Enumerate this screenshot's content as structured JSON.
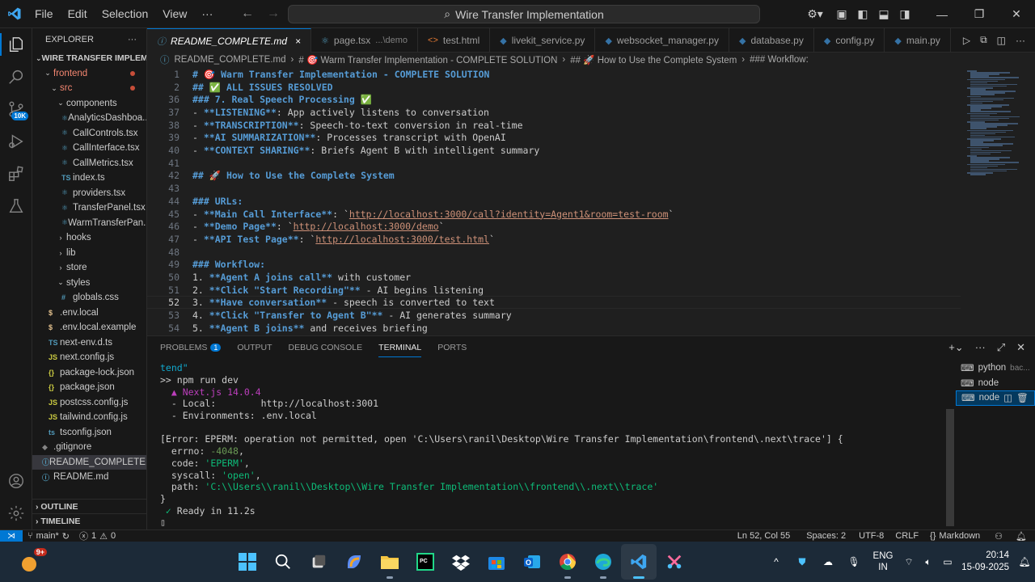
{
  "titlebar": {
    "menu": [
      "File",
      "Edit",
      "Selection",
      "View"
    ],
    "more": "···",
    "search": "Wire Transfer Implementation"
  },
  "activity": {
    "source_control_badge": "10K"
  },
  "explorer": {
    "title": "EXPLORER",
    "root": "WIRE TRANSFER IMPLEME...",
    "items": [
      {
        "label": "frontend",
        "indent": 1,
        "type": "folder-open",
        "modified": true
      },
      {
        "label": "src",
        "indent": 2,
        "type": "folder-open",
        "modified": true
      },
      {
        "label": "components",
        "indent": 3,
        "type": "folder-open"
      },
      {
        "label": "AnalyticsDashboa...",
        "indent": 4,
        "type": "tsx"
      },
      {
        "label": "CallControls.tsx",
        "indent": 4,
        "type": "tsx"
      },
      {
        "label": "CallInterface.tsx",
        "indent": 4,
        "type": "tsx"
      },
      {
        "label": "CallMetrics.tsx",
        "indent": 4,
        "type": "tsx"
      },
      {
        "label": "index.ts",
        "indent": 4,
        "type": "ts"
      },
      {
        "label": "providers.tsx",
        "indent": 4,
        "type": "tsx"
      },
      {
        "label": "TransferPanel.tsx",
        "indent": 4,
        "type": "tsx"
      },
      {
        "label": "WarmTransferPan...",
        "indent": 4,
        "type": "tsx"
      },
      {
        "label": "hooks",
        "indent": 3,
        "type": "folder"
      },
      {
        "label": "lib",
        "indent": 3,
        "type": "folder"
      },
      {
        "label": "store",
        "indent": 3,
        "type": "folder"
      },
      {
        "label": "styles",
        "indent": 3,
        "type": "folder-open"
      },
      {
        "label": "globals.css",
        "indent": 4,
        "type": "css"
      },
      {
        "label": ".env.local",
        "indent": 2,
        "type": "env"
      },
      {
        "label": ".env.local.example",
        "indent": 2,
        "type": "env"
      },
      {
        "label": "next-env.d.ts",
        "indent": 2,
        "type": "ts"
      },
      {
        "label": "next.config.js",
        "indent": 2,
        "type": "js"
      },
      {
        "label": "package-lock.json",
        "indent": 2,
        "type": "json"
      },
      {
        "label": "package.json",
        "indent": 2,
        "type": "json"
      },
      {
        "label": "postcss.config.js",
        "indent": 2,
        "type": "js"
      },
      {
        "label": "tailwind.config.js",
        "indent": 2,
        "type": "js"
      },
      {
        "label": "tsconfig.json",
        "indent": 2,
        "type": "tsconfig"
      },
      {
        "label": ".gitignore",
        "indent": 1,
        "type": "git"
      },
      {
        "label": "README_COMPLETE...",
        "indent": 1,
        "type": "md-info",
        "selected": true
      },
      {
        "label": "README.md",
        "indent": 1,
        "type": "md-info"
      }
    ],
    "outline": "OUTLINE",
    "timeline": "TIMELINE"
  },
  "tabs": [
    {
      "label": "README_COMPLETE.md",
      "icon": "info",
      "active": true,
      "close": "×"
    },
    {
      "label": "page.tsx",
      "desc": "...\\demo",
      "icon": "tsx"
    },
    {
      "label": "test.html",
      "icon": "html"
    },
    {
      "label": "livekit_service.py",
      "icon": "py"
    },
    {
      "label": "websocket_manager.py",
      "icon": "py"
    },
    {
      "label": "database.py",
      "icon": "py"
    },
    {
      "label": "config.py",
      "icon": "py"
    },
    {
      "label": "main.py",
      "icon": "py"
    }
  ],
  "breadcrumb": [
    "README_COMPLETE.md",
    "# 🎯 Warm Transfer Implementation - COMPLETE SOLUTION",
    "## 🚀 How to Use the Complete System",
    "### Workflow:"
  ],
  "editor": {
    "lines": [
      {
        "n": "1",
        "parts": [
          {
            "c": "h",
            "t": "# 🎯 Warm Transfer Implementation - COMPLETE SOLUTION"
          }
        ]
      },
      {
        "n": "2",
        "parts": [
          {
            "c": "h",
            "t": "## ✅ ALL ISSUES RESOLVED"
          }
        ]
      },
      {
        "n": "36",
        "parts": [
          {
            "c": "h",
            "t": "### 7. Real Speech Processing ✅"
          }
        ]
      },
      {
        "n": "37",
        "parts": [
          {
            "c": "t",
            "t": "- "
          },
          {
            "c": "b",
            "t": "**LISTENING**"
          },
          {
            "c": "t",
            "t": ": App actively listens to conversation"
          }
        ]
      },
      {
        "n": "38",
        "parts": [
          {
            "c": "t",
            "t": "- "
          },
          {
            "c": "b",
            "t": "**TRANSCRIPTION**"
          },
          {
            "c": "t",
            "t": ": Speech-to-text conversion in real-time"
          }
        ]
      },
      {
        "n": "39",
        "parts": [
          {
            "c": "t",
            "t": "- "
          },
          {
            "c": "b",
            "t": "**AI SUMMARIZATION**"
          },
          {
            "c": "t",
            "t": ": Processes transcript with OpenAI"
          }
        ]
      },
      {
        "n": "40",
        "parts": [
          {
            "c": "t",
            "t": "- "
          },
          {
            "c": "b",
            "t": "**CONTEXT SHARING**"
          },
          {
            "c": "t",
            "t": ": Briefs Agent B with intelligent summary"
          }
        ]
      },
      {
        "n": "41",
        "parts": []
      },
      {
        "n": "42",
        "parts": [
          {
            "c": "h",
            "t": "## 🚀 How to Use the Complete System"
          }
        ]
      },
      {
        "n": "43",
        "parts": []
      },
      {
        "n": "44",
        "parts": [
          {
            "c": "h",
            "t": "### URLs:"
          }
        ]
      },
      {
        "n": "45",
        "parts": [
          {
            "c": "t",
            "t": "- "
          },
          {
            "c": "b",
            "t": "**Main Call Interface**"
          },
          {
            "c": "t",
            "t": ": `"
          },
          {
            "c": "lk",
            "t": "http://localhost:3000/call?identity=Agent1&room=test-room"
          },
          {
            "c": "t",
            "t": "`"
          }
        ]
      },
      {
        "n": "46",
        "parts": [
          {
            "c": "t",
            "t": "- "
          },
          {
            "c": "b",
            "t": "**Demo Page**"
          },
          {
            "c": "t",
            "t": ": `"
          },
          {
            "c": "lk",
            "t": "http://localhost:3000/demo"
          },
          {
            "c": "t",
            "t": "`"
          }
        ]
      },
      {
        "n": "47",
        "parts": [
          {
            "c": "t",
            "t": "- "
          },
          {
            "c": "b",
            "t": "**API Test Page**"
          },
          {
            "c": "t",
            "t": ": `"
          },
          {
            "c": "lk",
            "t": "http://localhost:3000/test.html"
          },
          {
            "c": "t",
            "t": "`"
          }
        ]
      },
      {
        "n": "48",
        "parts": []
      },
      {
        "n": "49",
        "parts": [
          {
            "c": "h",
            "t": "### Workflow:"
          }
        ]
      },
      {
        "n": "50",
        "parts": [
          {
            "c": "t",
            "t": "1. "
          },
          {
            "c": "b",
            "t": "**Agent A joins call**"
          },
          {
            "c": "t",
            "t": " with customer"
          }
        ]
      },
      {
        "n": "51",
        "parts": [
          {
            "c": "t",
            "t": "2. "
          },
          {
            "c": "b",
            "t": "**Click \"Start Recording\"**"
          },
          {
            "c": "t",
            "t": " - AI begins listening"
          }
        ]
      },
      {
        "n": "52",
        "parts": [
          {
            "c": "t",
            "t": "3. "
          },
          {
            "c": "b",
            "t": "**Have conversation**"
          },
          {
            "c": "t",
            "t": " - speech is converted to text"
          }
        ],
        "current": true
      },
      {
        "n": "53",
        "parts": [
          {
            "c": "t",
            "t": "4. "
          },
          {
            "c": "b",
            "t": "**Click \"Transfer to Agent B\"**"
          },
          {
            "c": "t",
            "t": " - AI generates summary"
          }
        ]
      },
      {
        "n": "54",
        "parts": [
          {
            "c": "t",
            "t": "5. "
          },
          {
            "c": "b",
            "t": "**Agent B joins**"
          },
          {
            "c": "t",
            "t": " and receives briefing"
          }
        ]
      }
    ]
  },
  "panel": {
    "tabs": [
      {
        "label": "PROBLEMS",
        "badge": "1"
      },
      {
        "label": "OUTPUT"
      },
      {
        "label": "DEBUG CONSOLE"
      },
      {
        "label": "TERMINAL",
        "active": true
      },
      {
        "label": "PORTS"
      }
    ],
    "terminal": [
      {
        "parts": [
          {
            "c": "tc",
            "t": "tend\""
          }
        ]
      },
      {
        "parts": [
          {
            "c": "t",
            "t": ">> npm run dev"
          }
        ]
      },
      {
        "parts": [
          {
            "c": "tm",
            "t": "  ▲ Next.js 14.0.4"
          }
        ]
      },
      {
        "parts": [
          {
            "c": "t",
            "t": "  - Local:        http://localhost:3001"
          }
        ]
      },
      {
        "parts": [
          {
            "c": "t",
            "t": "  - Environments: .env.local"
          }
        ]
      },
      {
        "parts": []
      },
      {
        "parts": [
          {
            "c": "t",
            "t": "[Error: EPERM: operation not permitted, open 'C:\\Users\\ranil\\Desktop\\Wire Transfer Implementation\\frontend\\.next\\trace'] {"
          }
        ]
      },
      {
        "parts": [
          {
            "c": "t",
            "t": "  errno: "
          },
          {
            "c": "tgr",
            "t": "-4048"
          },
          {
            "c": "t",
            "t": ","
          }
        ]
      },
      {
        "parts": [
          {
            "c": "t",
            "t": "  code: "
          },
          {
            "c": "tg",
            "t": "'EPERM'"
          },
          {
            "c": "t",
            "t": ","
          }
        ]
      },
      {
        "parts": [
          {
            "c": "t",
            "t": "  syscall: "
          },
          {
            "c": "tg",
            "t": "'open'"
          },
          {
            "c": "t",
            "t": ","
          }
        ]
      },
      {
        "parts": [
          {
            "c": "t",
            "t": "  path: "
          },
          {
            "c": "tg",
            "t": "'C:\\\\Users\\\\ranil\\\\Desktop\\\\Wire Transfer Implementation\\\\frontend\\\\.next\\\\trace'"
          }
        ]
      },
      {
        "parts": [
          {
            "c": "t",
            "t": "}"
          }
        ]
      },
      {
        "parts": [
          {
            "c": "tg",
            "t": " ✓"
          },
          {
            "c": "t",
            "t": " Ready in 11.2s"
          }
        ]
      },
      {
        "parts": [
          {
            "c": "t",
            "t": "▯"
          }
        ]
      }
    ],
    "terminal_list": [
      {
        "label": "python",
        "desc": "bac..."
      },
      {
        "label": "node"
      },
      {
        "label": "node",
        "active": true
      }
    ]
  },
  "status": {
    "branch": "main*",
    "errors": "1",
    "warnings": "0",
    "position": "Ln 52, Col 55",
    "spaces": "Spaces: 2",
    "encoding": "UTF-8",
    "eol": "CRLF",
    "language": "Markdown"
  },
  "taskbar": {
    "weather_badge": "9+",
    "lang_top": "ENG",
    "lang_bottom": "IN",
    "time": "20:14",
    "date": "15-09-2025"
  },
  "colors": {
    "accent": "#0078d4",
    "editor_bg": "#1f1f1f",
    "heading": "#569cd6",
    "link": "#ce9178",
    "terminal_green": "#0dbc79"
  }
}
